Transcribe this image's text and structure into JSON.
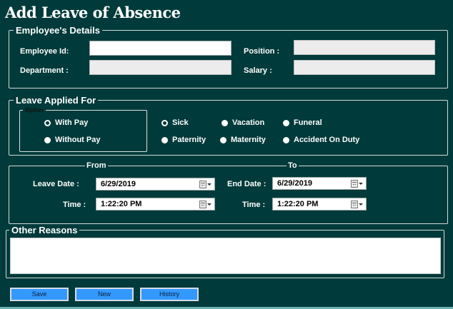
{
  "title": "Add Leave of Absence",
  "employee_details": {
    "legend": "Employee's Details",
    "employee_id_label": "Employee Id:",
    "employee_id_value": "",
    "department_label": "Department :",
    "department_value": "",
    "position_label": "Position :",
    "position_value": "",
    "salary_label": "Salary :",
    "salary_value": ""
  },
  "leave_applied": {
    "legend": "Leave Applied For",
    "option_legend": "Option",
    "pay_options": [
      {
        "label": "With Pay",
        "checked": true
      },
      {
        "label": "Without Pay",
        "checked": false
      }
    ],
    "leave_types": [
      {
        "label": "Sick",
        "checked": true
      },
      {
        "label": "Vacation",
        "checked": false
      },
      {
        "label": "Funeral",
        "checked": false
      },
      {
        "label": "Paternity",
        "checked": false
      },
      {
        "label": "Maternity",
        "checked": false
      },
      {
        "label": "Accident On Duty",
        "checked": false
      }
    ]
  },
  "dates": {
    "from_heading": "From",
    "to_heading": "To",
    "leave_date_label": "Leave Date :",
    "leave_date_value": "6/29/2019",
    "leave_time_label": "Time :",
    "leave_time_value": "1:22:20 PM",
    "end_date_label": "End Date :",
    "end_date_value": "6/29/2019",
    "end_time_label": "Time :",
    "end_time_value": "1:22:20 PM"
  },
  "other_reasons": {
    "legend": "Other Reasons",
    "value": ""
  },
  "buttons": {
    "save": "Save",
    "new": "New",
    "history": "History"
  },
  "colors": {
    "background": "#003a3a",
    "button": "#3399ff"
  }
}
